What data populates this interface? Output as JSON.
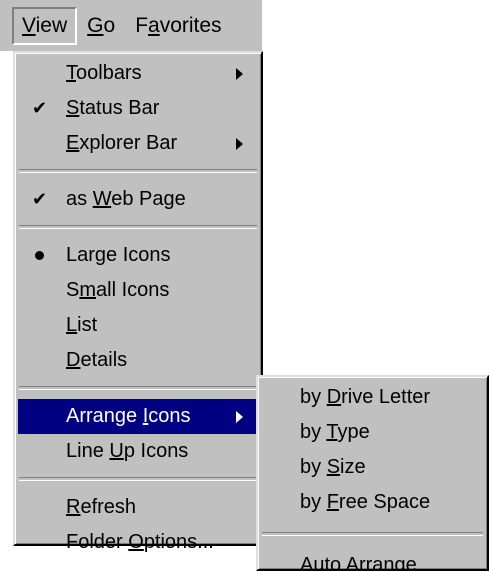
{
  "menubar": {
    "items": [
      {
        "before": "",
        "key": "V",
        "after": "iew"
      },
      {
        "before": "",
        "key": "G",
        "after": "o"
      },
      {
        "before": "F",
        "key": "a",
        "after": "vorites"
      }
    ]
  },
  "view_menu": {
    "toolbars": {
      "before": "",
      "key": "T",
      "after": "oolbars"
    },
    "status_bar": {
      "before": "",
      "key": "S",
      "after": "tatus Bar"
    },
    "explorer_bar": {
      "before": "",
      "key": "E",
      "after": "xplorer Bar"
    },
    "as_web_page": {
      "before": "as ",
      "key": "W",
      "after": "eb Page"
    },
    "large_icons": {
      "before": "Lar",
      "key": "g",
      "after": "e Icons"
    },
    "small_icons": {
      "before": "S",
      "key": "m",
      "after": "all Icons"
    },
    "list": {
      "before": "",
      "key": "L",
      "after": "ist"
    },
    "details": {
      "before": "",
      "key": "D",
      "after": "etails"
    },
    "arrange_icons": {
      "before": "Arrange ",
      "key": "I",
      "after": "cons"
    },
    "line_up_icons": {
      "before": "Line ",
      "key": "U",
      "after": "p Icons"
    },
    "refresh": {
      "before": "",
      "key": "R",
      "after": "efresh"
    },
    "folder_options": {
      "before": "Folder ",
      "key": "O",
      "after": "ptions..."
    },
    "check_glyph": "✔",
    "checked": [
      "status_bar",
      "as_web_page"
    ],
    "radio_selected": "large_icons",
    "highlighted": "arrange_icons"
  },
  "arrange_menu": {
    "by_drive_letter": {
      "before": "by ",
      "key": "D",
      "after": "rive Letter"
    },
    "by_type": {
      "before": "by ",
      "key": "T",
      "after": "ype"
    },
    "by_size": {
      "before": "by ",
      "key": "S",
      "after": "ize"
    },
    "by_free_space": {
      "before": "by ",
      "key": "F",
      "after": "ree Space"
    },
    "auto_arrange": {
      "before": "",
      "key": "A",
      "after": "uto Arrange"
    }
  },
  "colors": {
    "menu_face": "#c0c0c0",
    "highlight": "#000080",
    "highlight_text": "#ffffff"
  }
}
